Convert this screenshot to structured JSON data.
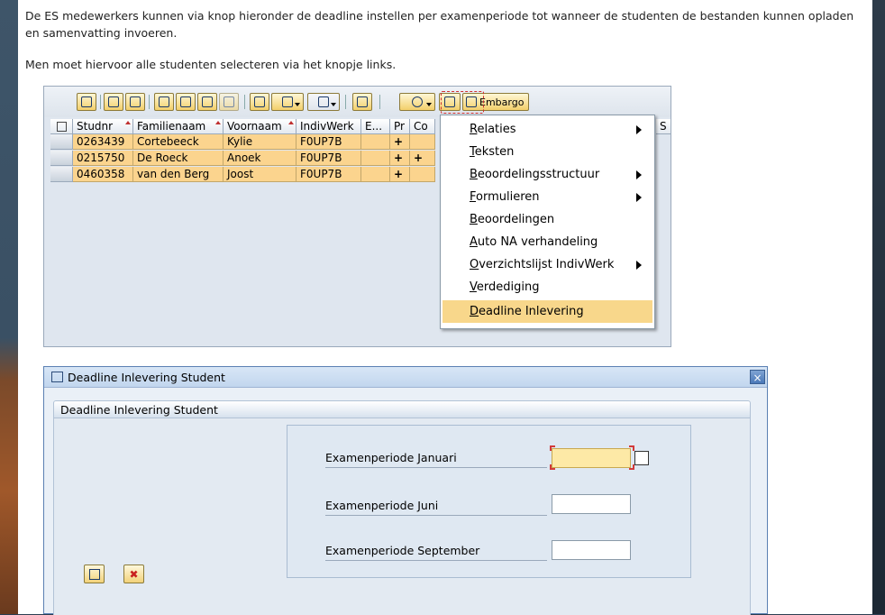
{
  "intro": {
    "paragraph1": "De ES medewerkers kunnen via knop hieronder de deadline instellen per examenperiode tot wanneer de studenten de bestanden kunnen opladen en samenvatting invoeren.",
    "paragraph2": "Men moet hiervoor alle studenten selecteren via het knopje links."
  },
  "toolbar": {
    "embargo_label": "Embargo"
  },
  "grid": {
    "columns": [
      "Studnr",
      "Familienaam",
      "Voornaam",
      "IndivWerk",
      "E...",
      "Pr",
      "Co",
      "S"
    ],
    "rows": [
      {
        "studnr": "0263439",
        "familienaam": "Cortebeeck",
        "voornaam": "Kylie",
        "indivwerk": "F0UP7B",
        "pr": "+",
        "co": ""
      },
      {
        "studnr": "0215750",
        "familienaam": "De Roeck",
        "voornaam": "Anoek",
        "indivwerk": "F0UP7B",
        "pr": "+",
        "co": "+"
      },
      {
        "studnr": "0460358",
        "familienaam": "van den Berg",
        "voornaam": "Joost",
        "indivwerk": "F0UP7B",
        "pr": "+",
        "co": ""
      }
    ]
  },
  "menu": {
    "items": [
      {
        "first": "R",
        "rest": "elaties",
        "submenu": true
      },
      {
        "first": "T",
        "rest": "eksten",
        "submenu": false
      },
      {
        "first": "B",
        "rest": "eoordelingsstructuur",
        "submenu": true
      },
      {
        "first": "F",
        "rest": "ormulieren",
        "submenu": true
      },
      {
        "first": "B",
        "rest": "eoordelingen",
        "submenu": false
      },
      {
        "first": "A",
        "rest": "uto NA verhandeling",
        "submenu": false
      },
      {
        "first": "O",
        "rest": "verzichtslijst IndivWerk",
        "submenu": true
      },
      {
        "first": "V",
        "rest": "erdediging",
        "submenu": false
      },
      {
        "first": "D",
        "rest": "eadline Inlevering",
        "submenu": false,
        "highlighted": true
      }
    ]
  },
  "dialog": {
    "title": "Deadline Inlevering Student",
    "close": "×",
    "group_title": "Deadline Inlevering Student",
    "fields": [
      {
        "label": "Examenperiode Januari",
        "value": ""
      },
      {
        "label": "Examenperiode Juni",
        "value": ""
      },
      {
        "label": "Examenperiode September",
        "value": ""
      }
    ],
    "cancel_glyph": "✖"
  },
  "colors": {
    "row_highlight": "#fbd48e",
    "menu_highlight": "#f8d78b",
    "dialog_title": "#c2d6ee"
  }
}
